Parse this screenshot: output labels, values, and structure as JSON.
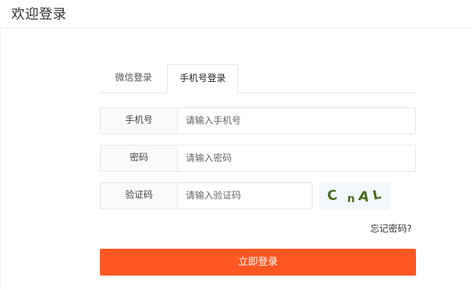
{
  "header": {
    "title": "欢迎登录"
  },
  "tabs": [
    {
      "label": "微信登录",
      "active": false
    },
    {
      "label": "手机号登录",
      "active": true
    }
  ],
  "form": {
    "phone": {
      "label": "手机号",
      "placeholder": "请输入手机号",
      "value": ""
    },
    "password": {
      "label": "密码",
      "placeholder": "请输入密码",
      "value": ""
    },
    "captcha": {
      "label": "验证码",
      "placeholder": "请输入验证码",
      "value": "",
      "image_text": "CnAL"
    }
  },
  "forgot_password": "忘记密码?",
  "submit_label": "立即登录",
  "colors": {
    "accent": "#ff5722",
    "captcha_bg": "#f2f8fb",
    "captcha_text": "#4a6b1e",
    "border": "#e6e6e6",
    "label_bg": "#fafafa"
  }
}
